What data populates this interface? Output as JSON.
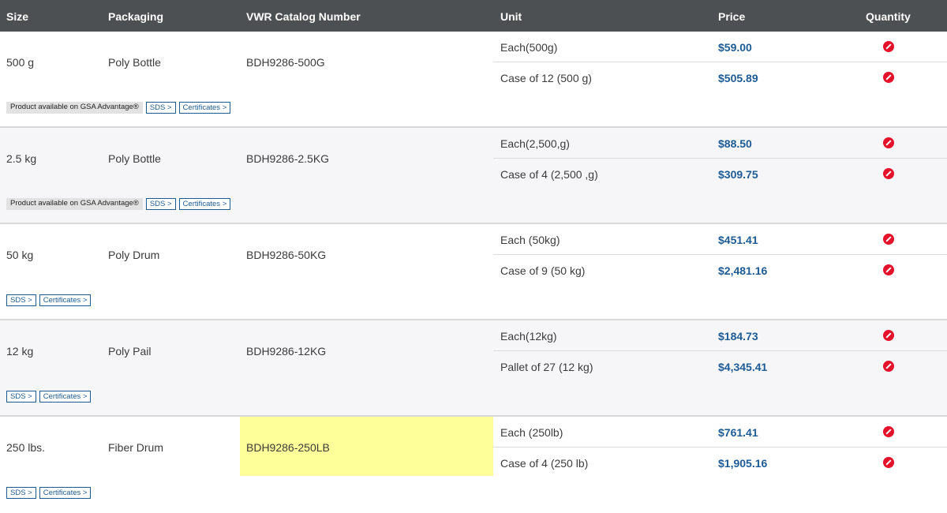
{
  "header": {
    "size": "Size",
    "packaging": "Packaging",
    "catalog": "VWR Catalog Number",
    "unit": "Unit",
    "price": "Price",
    "quantity": "Quantity"
  },
  "groups": [
    {
      "size": "500 g",
      "packaging": "Poly Bottle",
      "catalog": "BDH9286-500G",
      "units": [
        {
          "unit": "Each(500g)",
          "price": "$59.00"
        },
        {
          "unit": "Case of 12 (500 g)",
          "price": "$505.89"
        }
      ],
      "gsa": "Product available on GSA Advantage®",
      "sds": "SDS >",
      "certs": "Certificates >"
    },
    {
      "size": "2.5 kg",
      "packaging": "Poly Bottle",
      "catalog": "BDH9286-2.5KG",
      "units": [
        {
          "unit": "Each(2,500,g)",
          "price": "$88.50"
        },
        {
          "unit": "Case of 4 (2,500 ,g)",
          "price": "$309.75"
        }
      ],
      "gsa": "Product available on GSA Advantage®",
      "sds": "SDS >",
      "certs": "Certificates >"
    },
    {
      "size": "50 kg",
      "packaging": "Poly Drum",
      "catalog": "BDH9286-50KG",
      "units": [
        {
          "unit": "Each (50kg)",
          "price": "$451.41"
        },
        {
          "unit": "Case of 9 (50 kg)",
          "price": "$2,481.16"
        }
      ],
      "sds": "SDS >",
      "certs": "Certificates >"
    },
    {
      "size": "12 kg",
      "packaging": "Poly Pail",
      "catalog": "BDH9286-12KG",
      "units": [
        {
          "unit": "Each(12kg)",
          "price": "$184.73"
        },
        {
          "unit": "Pallet of 27 (12 kg)",
          "price": "$4,345.41"
        }
      ],
      "sds": "SDS >",
      "certs": "Certificates >"
    },
    {
      "size": "250 lbs.",
      "packaging": "Fiber Drum",
      "catalog": "BDH9286-250LB",
      "units": [
        {
          "unit": "Each (250lb)",
          "price": "$761.41"
        },
        {
          "unit": "Case of 4 (250 lb)",
          "price": "$1,905.16"
        }
      ],
      "sds": "SDS >",
      "certs": "Certificates >"
    }
  ],
  "colors": {
    "header_bg": "#4d5052",
    "price": "#1c5b94",
    "unavailable_icon": "#e4122a",
    "highlight": "#ffff99"
  },
  "icons": {
    "quantity": "unavailable-icon"
  }
}
